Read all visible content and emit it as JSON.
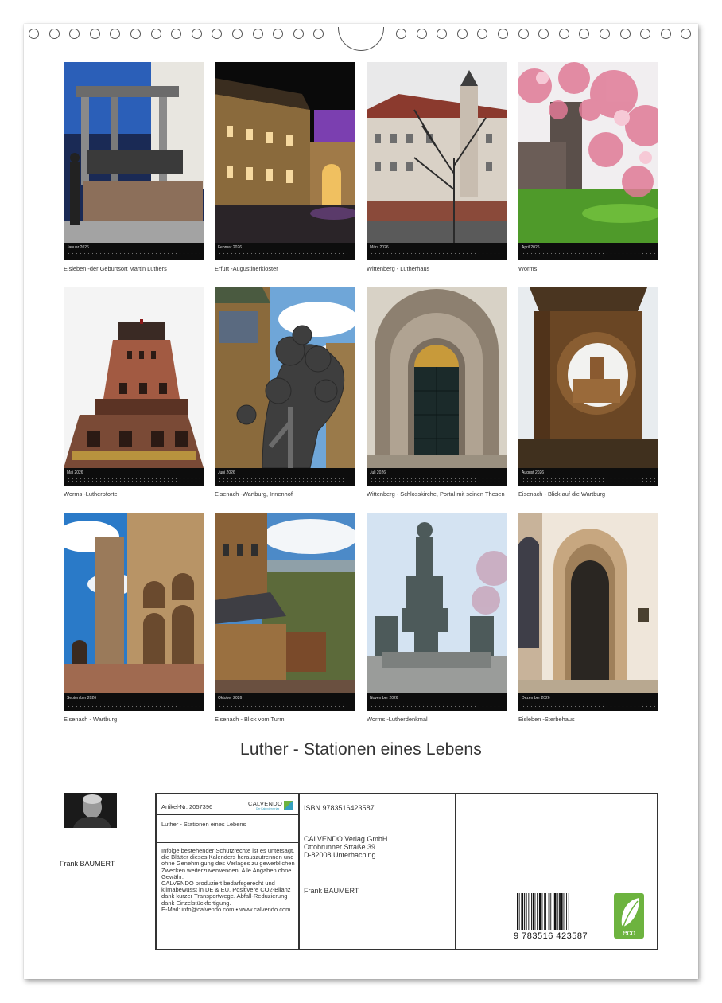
{
  "calendar": {
    "title": "Luther - Stationen eines Lebens",
    "months": [
      {
        "month": "Januar 2026",
        "caption": "Eisleben -der Geburtsort Martin Luthers"
      },
      {
        "month": "Februar 2026",
        "caption": "Erfurt -Augustinerkloster"
      },
      {
        "month": "März 2026",
        "caption": "Wittenberg - Lutherhaus"
      },
      {
        "month": "April 2026",
        "caption": "Worms"
      },
      {
        "month": "Mai 2026",
        "caption": "Worms -Lutherpforte"
      },
      {
        "month": "Juni 2026",
        "caption": "Eisenach -Wartburg, Innenhof"
      },
      {
        "month": "Juli 2026",
        "caption": "Wittenberg - Schlosskirche, Portal mit seinen Thesen"
      },
      {
        "month": "August 2026",
        "caption": "Eisenach - Blick auf die Wartburg"
      },
      {
        "month": "September 2026",
        "caption": "Eisenach - Wartburg"
      },
      {
        "month": "Oktober 2026",
        "caption": "Eisenach - Blick vom Turm"
      },
      {
        "month": "November 2026",
        "caption": "Worms -Lutherdenkmal"
      },
      {
        "month": "Dezember 2026",
        "caption": "Eisleben -Sterbehaus"
      }
    ]
  },
  "author": {
    "name": "Frank BAUMERT",
    "photo_icon": "author-portrait"
  },
  "info": {
    "article_number": "Artikel-Nr. 2057396",
    "calvendo_logo": "CALVENDO",
    "calvendo_tagline": "Der Kalenderverlag",
    "title": "Luther - Stationen eines Lebens",
    "legal_lines": [
      "Infolge bestehender Schutzrechte ist es untersagt, die Blätter dieses Kalenders herauszutrennen und ohne Genehmigung des Verlages zu gewerblichen Zwecken weiterzuverwenden. Alle Angaben ohne Gewähr.",
      "CALVENDO produziert bedarfsgerecht und klimabewusst in DE & EU. Positivere CO2-Bilanz dank kurzer Transportwege. Abfall-Reduzierung dank Einzelstückfertigung.",
      "E-Mail: info@calvendo.com • www.calvendo.com"
    ],
    "isbn": "ISBN 9783516423587",
    "publisher_lines": [
      "CALVENDO Verlag GmbH",
      "Ottobrunner Straße 39",
      "D-82008 Unterhaching"
    ],
    "author": "Frank BAUMERT",
    "barcode_digits": "9 783516 423587",
    "eco_label": "eco",
    "colors": {
      "eco_green": "#6db33f",
      "calvendo_blue": "#35a0c0"
    }
  }
}
